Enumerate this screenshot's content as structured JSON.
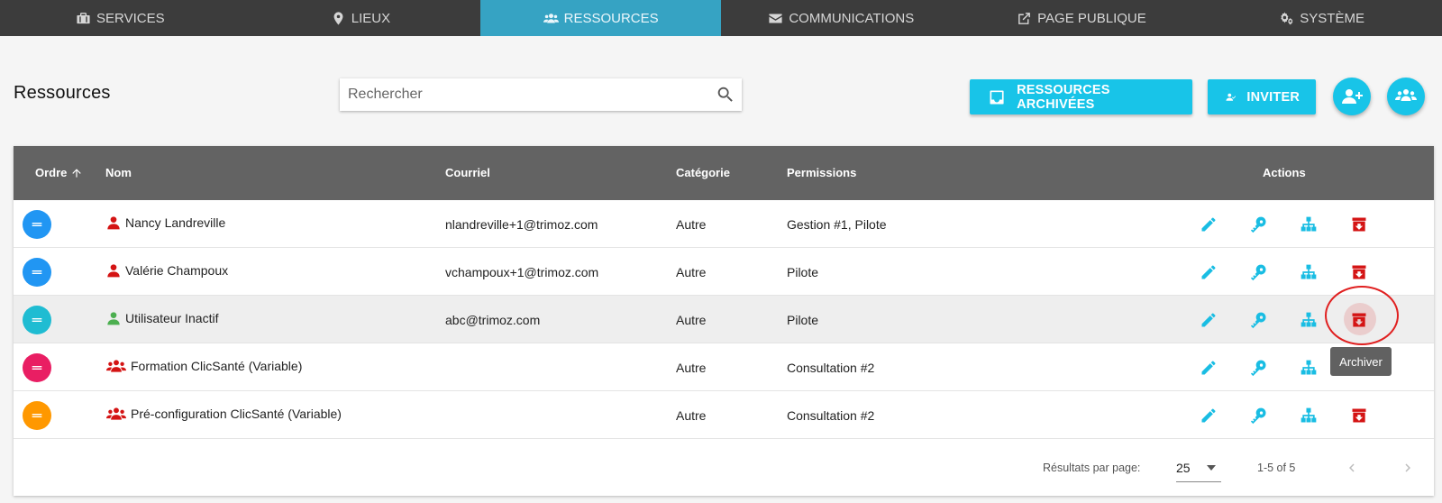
{
  "nav": {
    "items": [
      {
        "label": "SERVICES",
        "icon": "briefcase-icon"
      },
      {
        "label": "LIEUX",
        "icon": "map-pin-icon"
      },
      {
        "label": "RESSOURCES",
        "icon": "users-icon"
      },
      {
        "label": "COMMUNICATIONS",
        "icon": "envelope-icon"
      },
      {
        "label": "PAGE PUBLIQUE",
        "icon": "external-link-icon"
      },
      {
        "label": "SYSTÈME",
        "icon": "gears-icon"
      }
    ],
    "active": "RESSOURCES",
    "active_color": "#36a3c3"
  },
  "page": {
    "title": "Ressources"
  },
  "search": {
    "placeholder": "Rechercher",
    "value": ""
  },
  "buttons": {
    "archived": "RESSOURCES ARCHIVÉES",
    "invite": "INVITER",
    "color": "#18c4e8"
  },
  "table": {
    "headers": {
      "order": "Ordre",
      "name": "Nom",
      "email": "Courriel",
      "category": "Catégorie",
      "permissions": "Permissions",
      "actions": "Actions"
    },
    "rows": [
      {
        "name": "Nancy Landreville",
        "email": "nlandreville+1@trimoz.com",
        "category": "Autre",
        "permissions": "Gestion #1, Pilote",
        "type": "user-active",
        "dot_color": "#2196f3"
      },
      {
        "name": "Valérie Champoux",
        "email": "vchampoux+1@trimoz.com",
        "category": "Autre",
        "permissions": "Pilote",
        "type": "user-active",
        "dot_color": "#2196f3"
      },
      {
        "name": "Utilisateur Inactif",
        "email": "abc@trimoz.com",
        "category": "Autre",
        "permissions": "Pilote",
        "type": "user-inactive",
        "dot_color": "#1fbcd2"
      },
      {
        "name": "Formation ClicSanté (Variable)",
        "email": "",
        "category": "Autre",
        "permissions": "Consultation #2",
        "type": "group",
        "dot_color": "#e91e63"
      },
      {
        "name": "Pré-configuration ClicSanté (Variable)",
        "email": "",
        "category": "Autre",
        "permissions": "Consultation #2",
        "type": "group",
        "dot_color": "#ff9800"
      }
    ],
    "tooltip": "Archiver"
  },
  "pagination": {
    "rows_per_page_label": "Résultats par page:",
    "rows_per_page": "25",
    "range": "1-5 of 5"
  }
}
